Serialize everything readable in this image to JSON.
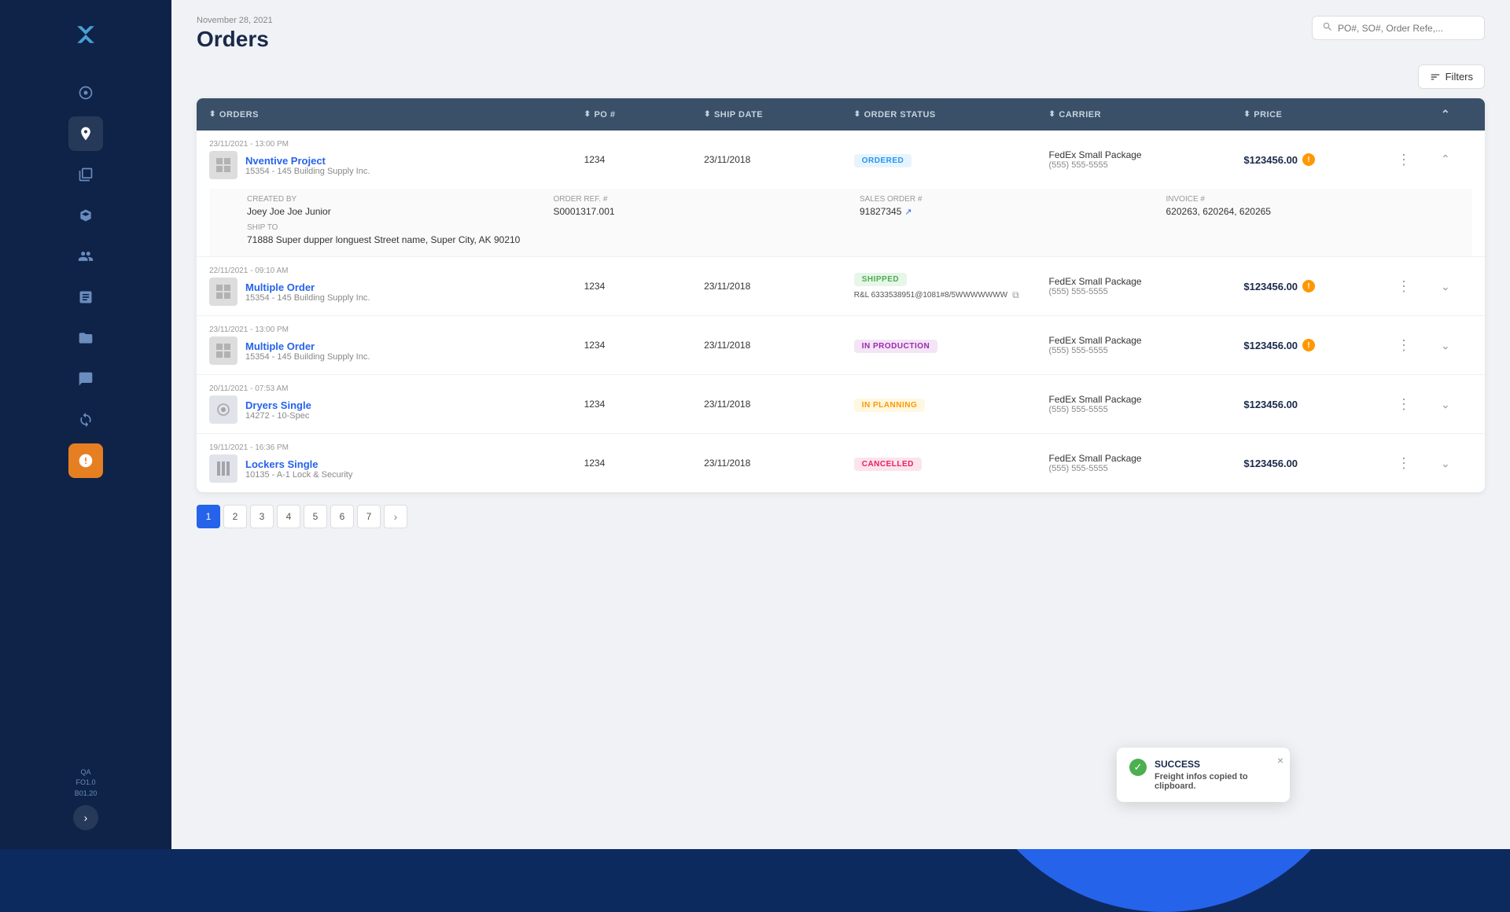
{
  "sidebar": {
    "logo_alt": "X Logo",
    "user": {
      "line1": "QA",
      "line2": "FO1.0",
      "line3": "B01.20"
    },
    "expand_label": "›"
  },
  "header": {
    "date": "November 28, 2021",
    "title": "Orders",
    "search_placeholder": "PO#, SO#, Order Refe,...",
    "filters_label": "Filters"
  },
  "table": {
    "columns": [
      "ORDERS",
      "PO #",
      "SHIP DATE",
      "ORDER STATUS",
      "CARRIER",
      "PRICE"
    ],
    "rows": [
      {
        "datetime": "23/11/2021 - 13:00 PM",
        "name": "Nventive Project",
        "sub": "15354 - 145 Building Supply Inc.",
        "po": "1234",
        "ship_date": "23/11/2018",
        "status": "ORDERED",
        "status_key": "ordered",
        "carrier_name": "FedEx Small Package",
        "carrier_phone": "(555) 555-5555",
        "price": "$123456.00",
        "has_warn": true,
        "expanded": true,
        "created_by_label": "Created By",
        "created_by": "Joey Joe Joe Junior",
        "order_ref_label": "Order Ref. #",
        "order_ref": "S0001317.001",
        "sales_order_label": "Sales Order #",
        "sales_order": "91827345",
        "invoice_label": "Invoice #",
        "invoice": "620263, 620264, 620265",
        "ship_to_label": "Ship To",
        "ship_to": "71888 Super dupper longuest Street name, Super City, AK 90210"
      },
      {
        "datetime": "22/11/2021 - 09:10 AM",
        "name": "Multiple Order",
        "sub": "15354 - 145 Building Supply Inc.",
        "po": "1234",
        "ship_date": "23/11/2018",
        "status": "SHIPPED",
        "status_key": "shipped",
        "carrier_name": "FedEx Small Package",
        "carrier_phone": "(555) 555-5555",
        "tracking": "R&L 6333538951@1081#8/5WWWWWWW",
        "price": "$123456.00",
        "has_warn": true,
        "expanded": false
      },
      {
        "datetime": "23/11/2021 - 13:00 PM",
        "name": "Multiple Order",
        "sub": "15354 - 145 Building Supply Inc.",
        "po": "1234",
        "ship_date": "23/11/2018",
        "status": "IN PRODUCTION",
        "status_key": "in-production",
        "carrier_name": "FedEx Small Package",
        "carrier_phone": "(555) 555-5555",
        "price": "$123456.00",
        "has_warn": true,
        "expanded": false
      },
      {
        "datetime": "20/11/2021 - 07:53 AM",
        "name": "Dryers Single",
        "sub": "14272 - 10-Spec",
        "po": "1234",
        "ship_date": "23/11/2018",
        "status": "IN PLANNING",
        "status_key": "in-planning",
        "carrier_name": "FedEx Small Package",
        "carrier_phone": "(555) 555-5555",
        "price": "$123456.00",
        "has_warn": false,
        "expanded": false
      },
      {
        "datetime": "19/11/2021 - 16:36 PM",
        "name": "Lockers Single",
        "sub": "10135 - A-1 Lock & Security",
        "po": "1234",
        "ship_date": "23/11/2018",
        "status": "CANCELLED",
        "status_key": "cancelled",
        "carrier_name": "FedEx Small Package",
        "carrier_phone": "(555) 555-5555",
        "price": "$123456.00",
        "has_warn": false,
        "expanded": false
      }
    ]
  },
  "pagination": {
    "pages": [
      "1",
      "2",
      "3",
      "4",
      "5",
      "6",
      "7"
    ],
    "current": "1",
    "next_label": "›"
  },
  "toast": {
    "title": "SUCCESS",
    "message_prefix": "Freight infos copied to",
    "message_target": "clipboard",
    "message_suffix": ".",
    "close_label": "×"
  }
}
